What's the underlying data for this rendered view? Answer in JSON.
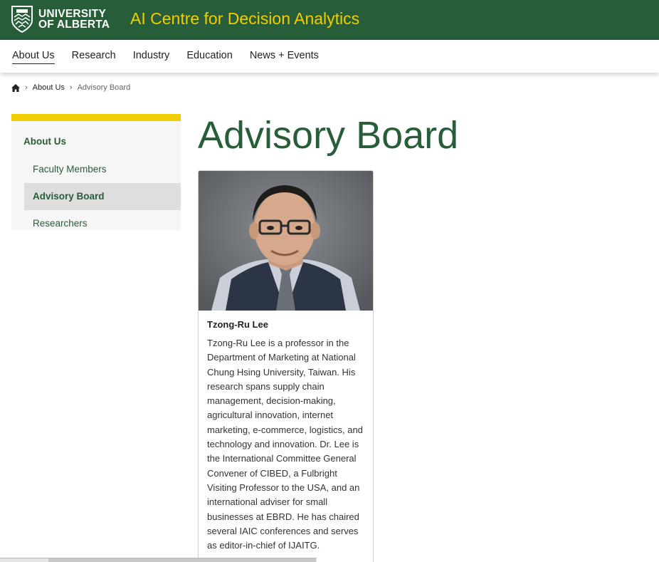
{
  "header": {
    "logo_line1": "UNIVERSITY",
    "logo_line2": "OF ALBERTA",
    "site_title": "AI Centre for Decision Analytics",
    "brand_green": "#275d38",
    "brand_gold": "#f2cd00"
  },
  "nav": {
    "items": [
      {
        "label": "About Us",
        "active": true
      },
      {
        "label": "Research"
      },
      {
        "label": "Industry"
      },
      {
        "label": "Education"
      },
      {
        "label": "News + Events"
      }
    ]
  },
  "breadcrumb": {
    "home_icon": "home-icon",
    "separator": ">",
    "items": [
      "About Us",
      "Advisory Board"
    ]
  },
  "sidebar": {
    "heading": "About Us",
    "items": [
      {
        "label": "Faculty Members"
      },
      {
        "label": "Advisory Board",
        "active": true
      },
      {
        "label": "Researchers"
      }
    ]
  },
  "main": {
    "title": "Advisory Board",
    "cards": [
      {
        "name": "Tzong-Ru Lee",
        "bio": "Tzong-Ru Lee is a professor in the Department of Marketing at National Chung Hsing University, Taiwan. His research spans supply chain management, decision-making, agricultural innovation, internet marketing, e-commerce, logistics, and technology and innovation. Dr. Lee is the International Committee General Convener of CIBED, a Fulbright Visiting Professor to the USA, and an international adviser for small businesses at EBRD. He has chaired several IAIC conferences and serves as editor-in-chief of IJAITG."
      }
    ]
  }
}
